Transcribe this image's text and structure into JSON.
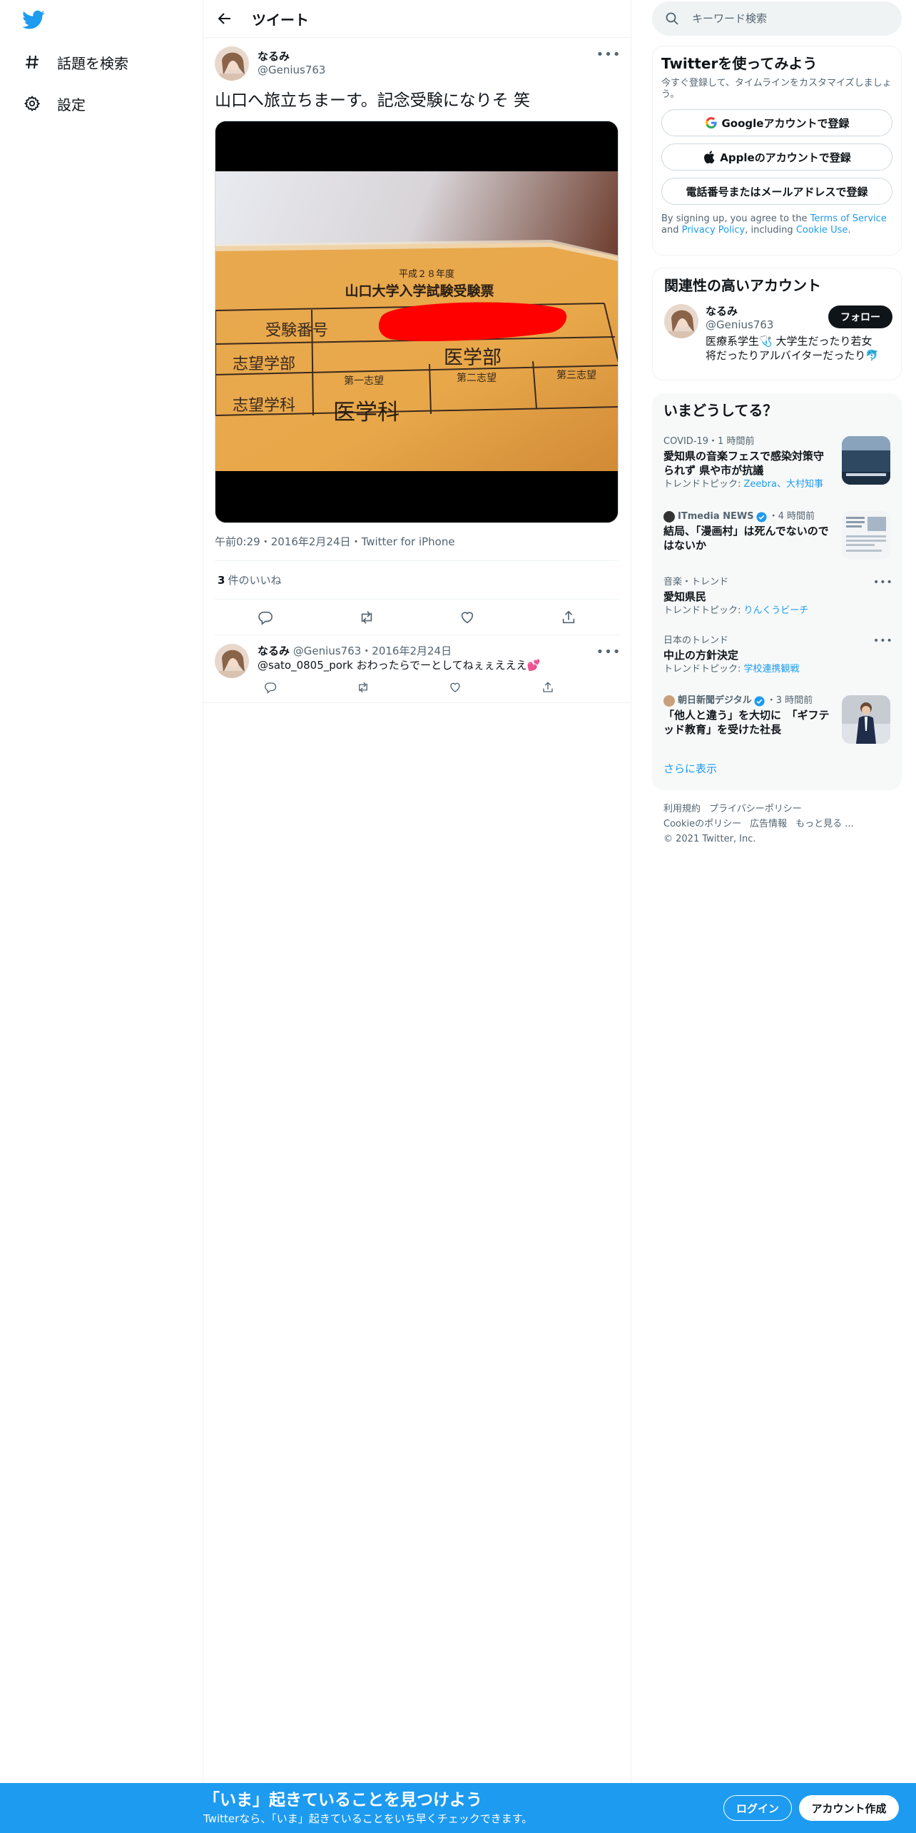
{
  "nav": {
    "logo": "twitter-bird-icon",
    "items": [
      {
        "label": "話題を検索",
        "icon": "hashtag-icon"
      },
      {
        "label": "設定",
        "icon": "gear-icon"
      }
    ]
  },
  "header": {
    "title": "ツイート"
  },
  "tweet": {
    "author_name": "なるみ",
    "author_handle": "@Genius763",
    "text": "山口へ旅立ちまーす。記念受験になりそ  笑",
    "image": {
      "heading1": "平成２８年度",
      "heading2": "山口大学入学試験受験票",
      "row1_label": "受験番号",
      "row2_label": "志望学部",
      "row2_value": "医学部",
      "row3_label": "志望学科",
      "row3_value": "医学科",
      "col1": "第一志望",
      "col2": "第二志望",
      "col3": "第三志望"
    },
    "time": "午前0:29",
    "date": "2016年2月24日",
    "source": "Twitter for iPhone",
    "sep": "・",
    "likes_count": "3",
    "likes_label": "件のいいね"
  },
  "reply": {
    "author_name": "なるみ",
    "author_handle": "@Genius763",
    "date": "2016年2月24日",
    "sep": "・",
    "mention": "@sato_0805_pork",
    "text": " おわったらでーとしてねぇぇえええ💕"
  },
  "search": {
    "placeholder": "キーワード検索"
  },
  "signup": {
    "title": "Twitterを使ってみよう",
    "subtitle": "今すぐ登録して、タイムラインをカスタマイズしましょう。",
    "google_label": "Googleアカウントで登録",
    "apple_label": "Appleのアカウントで登録",
    "phone_label": "電話番号またはメールアドレスで登録",
    "terms_prefix": "By signing up, you agree to the ",
    "terms_link": "Terms of Service",
    "terms_and": " and ",
    "privacy_link": "Privacy Policy",
    "terms_including": ", including ",
    "cookie_link": "Cookie Use",
    "terms_end": "."
  },
  "related": {
    "title": "関連性の高いアカウント",
    "name": "なるみ",
    "handle": "@Genius763",
    "bio": "医療系学生🩺 大学生だったり若女将だったりアルバイターだったり🐬",
    "follow_label": "フォロー"
  },
  "trends": {
    "title": "いまどうしてる？",
    "items": [
      {
        "context": "COVID-19・1 時間前",
        "title": "愛知県の音楽フェスで感染対策守られず 県や市が抗議",
        "topic_prefix": "トレンドトピック: ",
        "topics": "Zeebra、大村知事"
      },
      {
        "context_source": "ITmedia NEWS",
        "context_time": "・4 時間前",
        "title": "結局、「漫画村」は死んでないのではないか"
      },
      {
        "context": "音楽・トレンド",
        "title": "愛知県民",
        "topic_prefix": "トレンドトピック: ",
        "topics": "りんくうビーチ"
      },
      {
        "context": "日本のトレンド",
        "title": "中止の方針決定",
        "topic_prefix": "トレンドトピック: ",
        "topics": "学校連携観戦"
      },
      {
        "context_source": "朝日新聞デジタル",
        "context_time": "・3 時間前",
        "title": "「他人と違う」を大切に　「ギフテッド教育」を受けた社長"
      }
    ],
    "show_more": "さらに表示"
  },
  "footer": {
    "terms": "利用規約",
    "privacy": "プライバシーポリシー",
    "cookie": "Cookieのポリシー",
    "ads": "広告情報",
    "more": "もっと見る ...",
    "copyright": "© 2021 Twitter, Inc."
  },
  "bottom_bar": {
    "title": "「いま」起きていることを見つけよう",
    "subtitle": "Twitterなら、「いま」起きていることをいち早くチェックできます。",
    "login_label": "ログイン",
    "signup_label": "アカウント作成"
  },
  "colors": {
    "accent": "#1d9bf0",
    "text": "#0f1419",
    "secondary": "#536471",
    "follow_bg": "#0f1419"
  }
}
